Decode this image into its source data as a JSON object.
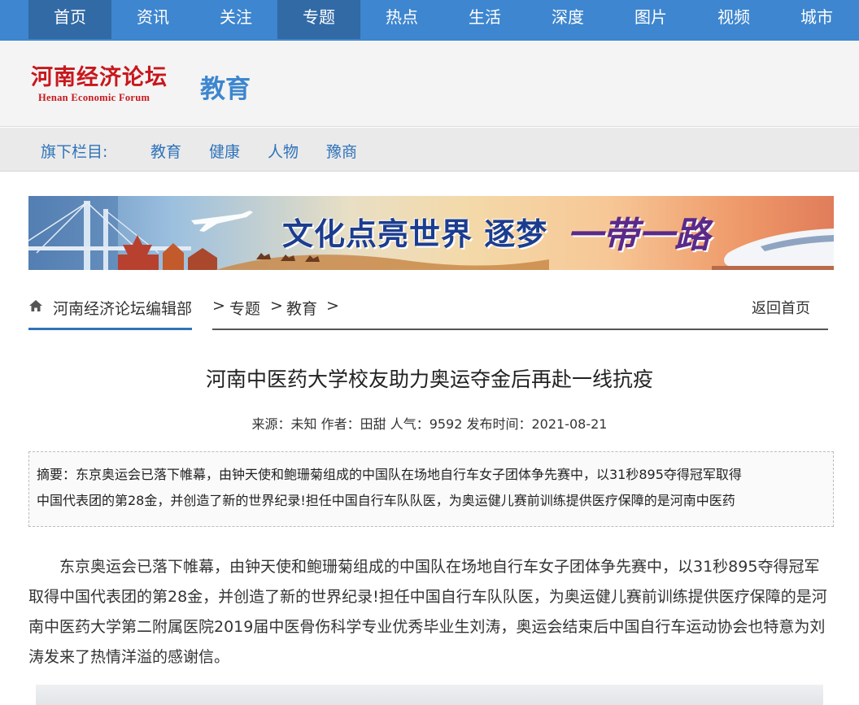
{
  "topnav": {
    "items": [
      {
        "label": "首页",
        "active": true
      },
      {
        "label": "资讯",
        "active": false
      },
      {
        "label": "关注",
        "active": false
      },
      {
        "label": "专题",
        "active": true
      },
      {
        "label": "热点",
        "active": false
      },
      {
        "label": "生活",
        "active": false
      },
      {
        "label": "深度",
        "active": false
      },
      {
        "label": "图片",
        "active": false
      },
      {
        "label": "视频",
        "active": false
      },
      {
        "label": "城市",
        "active": false
      }
    ],
    "bg_color": "#3e86cf",
    "active_color": "#326aa6"
  },
  "header": {
    "logo_cn": "河南经济论坛",
    "logo_en": "Henan Economic Forum",
    "section": "教育",
    "logo_color": "#c8171d"
  },
  "subnav": {
    "label": "旗下栏目:",
    "links": [
      "教育",
      "健康",
      "人物",
      "豫商"
    ]
  },
  "banner": {
    "slogan": "文化点亮世界  逐梦",
    "script": "一带一路"
  },
  "breadcrumb": {
    "items": [
      "河南经济论坛编辑部",
      ">",
      "专题",
      ">",
      "教育",
      ">"
    ],
    "back": "返回首页"
  },
  "article": {
    "title": "河南中医药大学校友助力奥运夺金后再赴一线抗疫",
    "meta": "来源：未知 作者：田甜 人气：9592 发布时间：2021-08-21",
    "summary_line1": "摘要：东京奥运会已落下帷幕，由钟天使和鲍珊菊组成的中国队在场地自行车女子团体争先赛中，以31秒895夺得冠军取得",
    "summary_line2": "中国代表团的第28金，并创造了新的世界纪录!担任中国自行车队队医，为奥运健儿赛前训练提供医疗保障的是河南中医药",
    "body": "东京奥运会已落下帷幕，由钟天使和鲍珊菊组成的中国队在场地自行车女子团体争先赛中，以31秒895夺得冠军取得中国代表团的第28金，并创造了新的世界纪录!担任中国自行车队队医，为奥运健儿赛前训练提供医疗保障的是河南中医药大学第二附属医院2019届中医骨伤科学专业优秀毕业生刘涛，奥运会结束后中国自行车运动协会也特意为刘涛发来了热情洋溢的感谢信。"
  }
}
